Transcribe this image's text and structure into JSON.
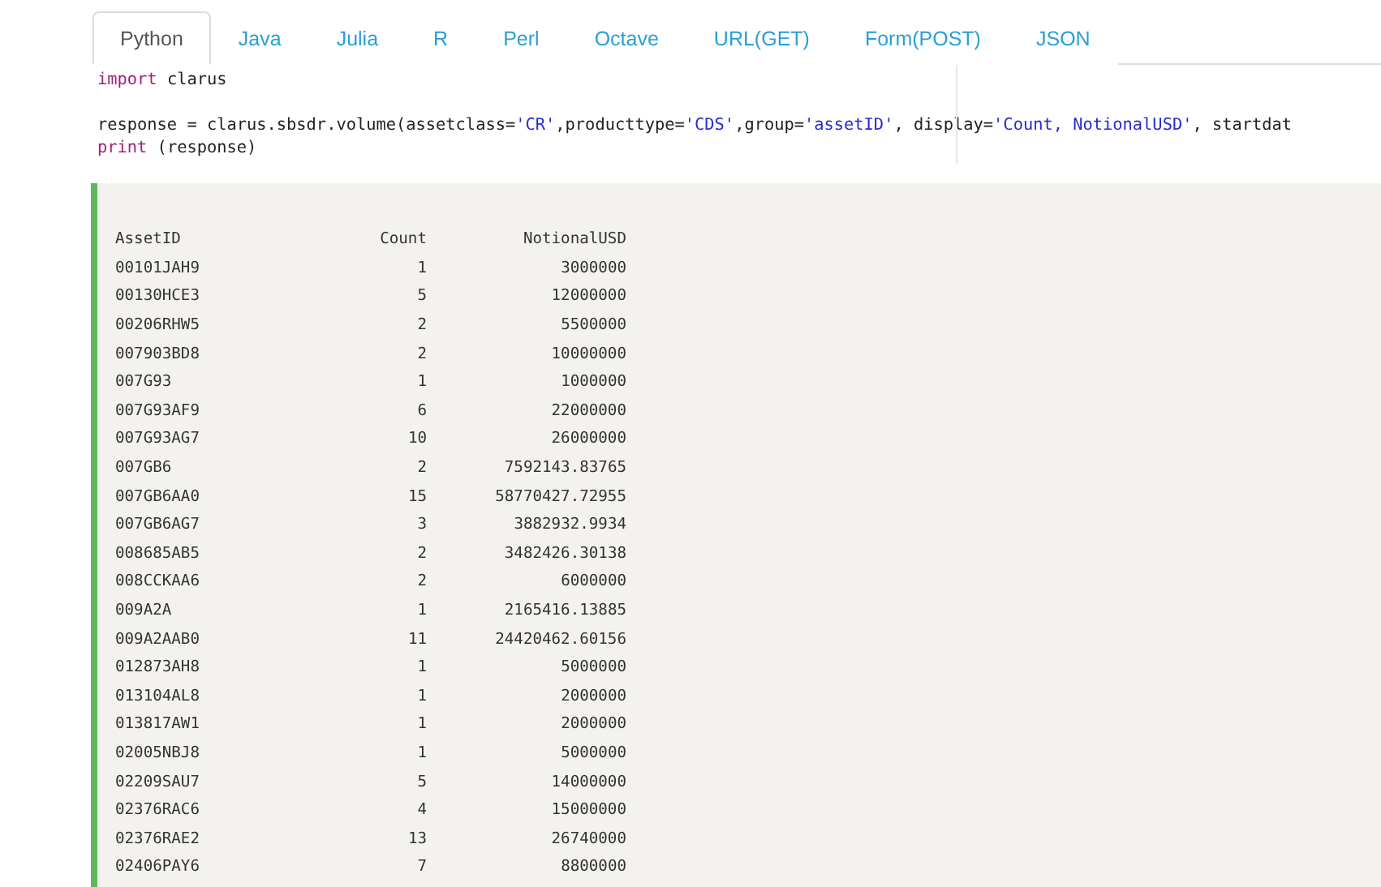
{
  "tabs": [
    {
      "label": "Python",
      "selected": true
    },
    {
      "label": "Java",
      "selected": false
    },
    {
      "label": "Julia",
      "selected": false
    },
    {
      "label": "R",
      "selected": false
    },
    {
      "label": "Perl",
      "selected": false
    },
    {
      "label": "Octave",
      "selected": false
    },
    {
      "label": "URL(GET)",
      "selected": false
    },
    {
      "label": "Form(POST)",
      "selected": false
    },
    {
      "label": "JSON",
      "selected": false
    }
  ],
  "code": {
    "paragraphs": [
      [
        {
          "tokens": [
            {
              "kind": "keyword",
              "text": "import"
            },
            {
              "kind": "plain",
              "text": " clarus"
            }
          ]
        }
      ],
      [
        {
          "tokens": [
            {
              "kind": "plain",
              "text": "response = clarus.sbsdr.volume(assetclass="
            },
            {
              "kind": "string",
              "text": "'CR'"
            },
            {
              "kind": "plain",
              "text": ",producttype="
            },
            {
              "kind": "string",
              "text": "'CDS'"
            },
            {
              "kind": "plain",
              "text": ",group="
            },
            {
              "kind": "string",
              "text": "'assetID'"
            },
            {
              "kind": "plain",
              "text": ", display="
            },
            {
              "kind": "string",
              "text": "'Count, NotionalUSD'"
            },
            {
              "kind": "plain",
              "text": ", startdat"
            }
          ]
        },
        {
          "tokens": [
            {
              "kind": "keyword",
              "text": "print"
            },
            {
              "kind": "plain",
              "text": " (response)"
            }
          ]
        }
      ]
    ]
  },
  "output": {
    "columns": [
      "AssetID",
      "Count",
      "NotionalUSD"
    ],
    "rows": [
      [
        "00101JAH9",
        "1",
        "3000000"
      ],
      [
        "00130HCE3",
        "5",
        "12000000"
      ],
      [
        "00206RHW5",
        "2",
        "5500000"
      ],
      [
        "007903BD8",
        "2",
        "10000000"
      ],
      [
        "007G93",
        "1",
        "1000000"
      ],
      [
        "007G93AF9",
        "6",
        "22000000"
      ],
      [
        "007G93AG7",
        "10",
        "26000000"
      ],
      [
        "007GB6",
        "2",
        "7592143.83765"
      ],
      [
        "007GB6AA0",
        "15",
        "58770427.72955"
      ],
      [
        "007GB6AG7",
        "3",
        "3882932.9934"
      ],
      [
        "008685AB5",
        "2",
        "3482426.30138"
      ],
      [
        "008CCKAA6",
        "2",
        "6000000"
      ],
      [
        "009A2A",
        "1",
        "2165416.13885"
      ],
      [
        "009A2AAB0",
        "11",
        "24420462.60156"
      ],
      [
        "012873AH8",
        "1",
        "5000000"
      ],
      [
        "013104AL8",
        "1",
        "2000000"
      ],
      [
        "013817AW1",
        "1",
        "2000000"
      ],
      [
        "02005NBJ8",
        "1",
        "5000000"
      ],
      [
        "02209SAU7",
        "5",
        "14000000"
      ],
      [
        "02376RAC6",
        "4",
        "15000000"
      ],
      [
        "02376RAE2",
        "13",
        "26740000"
      ],
      [
        "02406PAY6",
        "7",
        "8800000"
      ]
    ]
  }
}
